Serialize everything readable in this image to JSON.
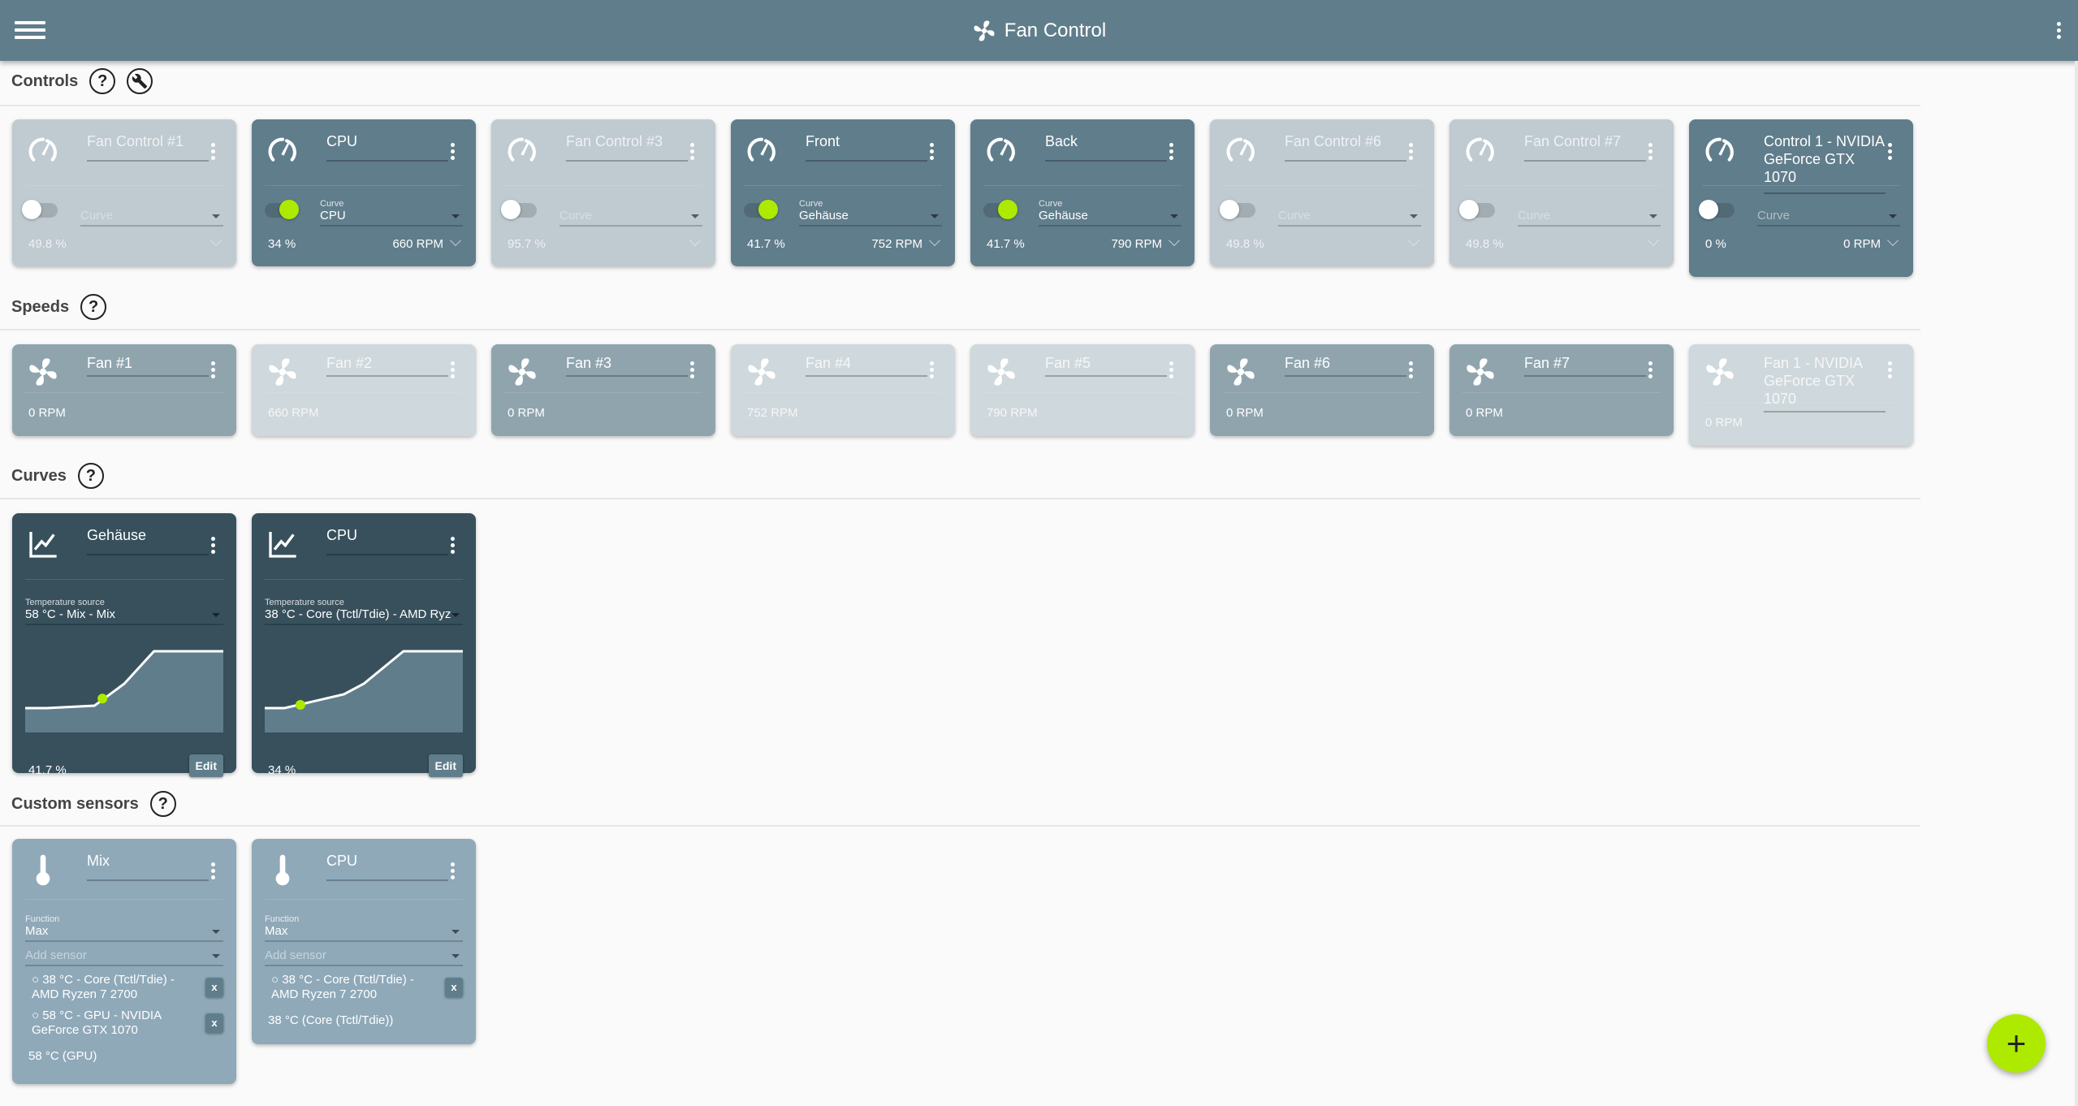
{
  "app": {
    "title": "Fan Control",
    "icons": {
      "menu": "menu-icon",
      "logo": "fan-icon",
      "more": "more-vert-icon"
    }
  },
  "colors": {
    "header": "#607d8b",
    "accent": "#aeea00",
    "curve_card": "#37505c"
  },
  "sections": {
    "controls": "Controls",
    "speeds": "Speeds",
    "curves": "Curves",
    "custom_sensors": "Custom sensors"
  },
  "controls": [
    {
      "name": "Fan Control #1",
      "enabled": false,
      "toggle_on": false,
      "curve_label": "Curve",
      "curve": "",
      "percent": "49.8 %",
      "rpm": ""
    },
    {
      "name": "CPU",
      "enabled": true,
      "toggle_on": true,
      "curve_label": "Curve",
      "curve": "CPU",
      "percent": "34 %",
      "rpm": "660 RPM"
    },
    {
      "name": "Fan Control #3",
      "enabled": false,
      "toggle_on": false,
      "curve_label": "Curve",
      "curve": "",
      "percent": "95.7 %",
      "rpm": ""
    },
    {
      "name": "Front",
      "enabled": true,
      "toggle_on": true,
      "curve_label": "Curve",
      "curve": "Gehäuse",
      "percent": "41.7 %",
      "rpm": "752 RPM"
    },
    {
      "name": "Back",
      "enabled": true,
      "toggle_on": true,
      "curve_label": "Curve",
      "curve": "Gehäuse",
      "percent": "41.7 %",
      "rpm": "790 RPM"
    },
    {
      "name": "Fan Control #6",
      "enabled": false,
      "toggle_on": false,
      "curve_label": "Curve",
      "curve": "",
      "percent": "49.8 %",
      "rpm": ""
    },
    {
      "name": "Fan Control #7",
      "enabled": false,
      "toggle_on": false,
      "curve_label": "Curve",
      "curve": "",
      "percent": "49.8 %",
      "rpm": ""
    },
    {
      "name": "Control 1 - NVIDIA GeForce GTX 1070",
      "enabled": true,
      "toggle_on": false,
      "curve_label": "Curve",
      "curve": "",
      "percent": "0 %",
      "rpm": "0 RPM"
    }
  ],
  "speeds": [
    {
      "name": "Fan #1",
      "enabled": true,
      "rpm": "0 RPM"
    },
    {
      "name": "Fan #2",
      "enabled": false,
      "rpm": "660 RPM"
    },
    {
      "name": "Fan #3",
      "enabled": true,
      "rpm": "0 RPM"
    },
    {
      "name": "Fan #4",
      "enabled": false,
      "rpm": "752 RPM"
    },
    {
      "name": "Fan #5",
      "enabled": false,
      "rpm": "790 RPM"
    },
    {
      "name": "Fan #6",
      "enabled": true,
      "rpm": "0 RPM"
    },
    {
      "name": "Fan #7",
      "enabled": true,
      "rpm": "0 RPM"
    },
    {
      "name": "Fan 1 - NVIDIA GeForce GTX 1070",
      "enabled": false,
      "rpm": "0 RPM"
    }
  ],
  "curves": [
    {
      "name": "Gehäuse",
      "source_label": "Temperature source",
      "source": "58 °C - Mix - Mix",
      "percent": "41.7 %",
      "current_value": 41.7,
      "edit": "Edit"
    },
    {
      "name": "CPU",
      "source_label": "Temperature source",
      "source": "38 °C - Core (Tctl/Tdie) - AMD Ryz",
      "percent": "34 %",
      "current_value": 34,
      "edit": "Edit"
    }
  ],
  "custom_sensors": [
    {
      "name": "Mix",
      "function_label": "Function",
      "function": "Max",
      "add_placeholder": "Add sensor",
      "sensors": [
        "○ 38 °C - Core (Tctl/Tdie) - AMD Ryzen 7 2700",
        "○ 58 °C - GPU - NVIDIA GeForce GTX 1070"
      ],
      "remove": "x",
      "result": "58 °C (GPU)"
    },
    {
      "name": "CPU",
      "function_label": "Function",
      "function": "Max",
      "add_placeholder": "Add sensor",
      "sensors": [
        "○ 38 °C - Core (Tctl/Tdie) - AMD Ryzen 7 2700"
      ],
      "remove": "x",
      "result": "38 °C (Core (Tctl/Tdie))"
    }
  ],
  "fab": {
    "label": "+"
  }
}
